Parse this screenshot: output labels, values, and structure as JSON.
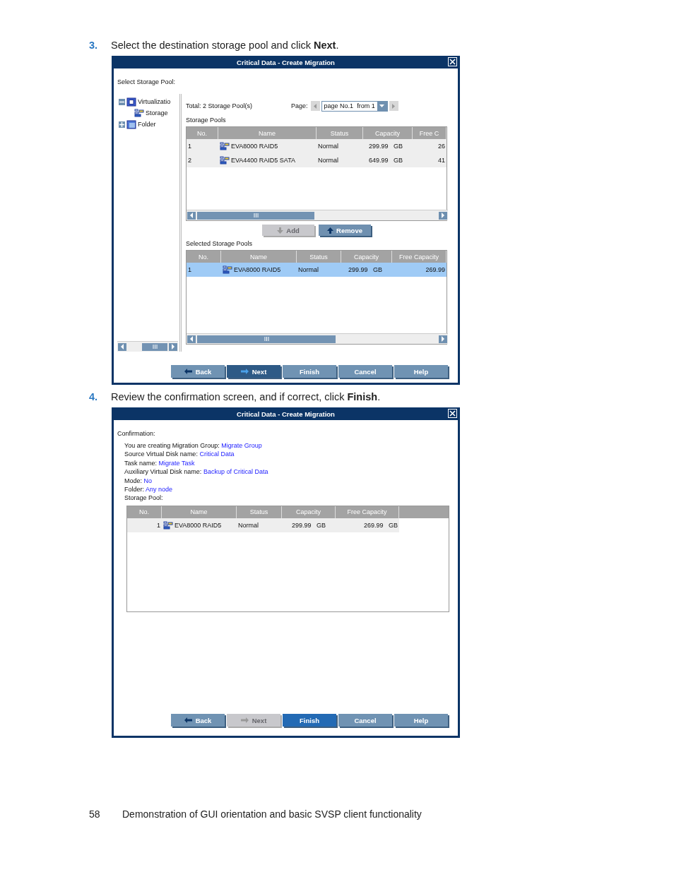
{
  "steps": [
    {
      "number": "3.",
      "text": "Select the destination storage pool and click **Next**.",
      "dialog": {
        "kind": "select_pool",
        "title": "Critical Data - Create Migration",
        "prompt": "Select Storage Pool:",
        "tree": [
          {
            "label": "Virtualizatio",
            "kind": "virtualization",
            "expanded": true,
            "children": [
              {
                "label": "Storage",
                "kind": "storage"
              }
            ]
          },
          {
            "label": "Folder",
            "kind": "folder",
            "expanded": false
          }
        ],
        "total": "Total: 2 Storage Pool(s)",
        "page_label": "Page:",
        "page_select": "page No.1  from 1",
        "available": {
          "label": "Storage Pools",
          "columns": [
            "No.",
            "Name",
            "Status",
            "Capacity",
            "Free C"
          ],
          "rows": [
            {
              "selected": false,
              "cells": [
                "1",
                "EVA8000 RAID5",
                "Normal",
                "299.99   GB",
                "26"
              ]
            },
            {
              "selected": false,
              "cells": [
                "2",
                "EVA4400 RAID5 SATA",
                "Normal",
                "649.99   GB",
                "41"
              ]
            }
          ]
        },
        "add_button": {
          "label": "Add",
          "disabled": true
        },
        "remove_button": {
          "label": "Remove",
          "disabled": false
        },
        "selected": {
          "label": "Selected Storage Pools",
          "columns": [
            "No.",
            "Name",
            "Status",
            "Capacity",
            "Free Capacity"
          ],
          "rows": [
            {
              "selected": true,
              "cells": [
                "1",
                "EVA8000 RAID5",
                "Normal",
                "299.99   GB",
                "269.99"
              ]
            }
          ]
        },
        "nav": [
          {
            "label": "Back",
            "kind": "normal"
          },
          {
            "label": "Next",
            "kind": "pressed"
          },
          {
            "label": "Finish",
            "kind": "normal"
          },
          {
            "label": "Cancel",
            "kind": "normal"
          },
          {
            "label": "Help",
            "kind": "normal"
          }
        ]
      }
    },
    {
      "number": "4.",
      "text": "Review the confirmation screen, and if correct, click **Finish**.",
      "dialog": {
        "kind": "confirm",
        "title": "Critical Data - Create Migration",
        "prompt": "Confirmation:",
        "details": [
          {
            "label": "You are creating Migration Group:",
            "value": "Migrate Group"
          },
          {
            "label": "Source Virtual Disk name:",
            "value": "Critical Data"
          },
          {
            "label": "Task name:",
            "value": "Migrate Task"
          },
          {
            "label": "Auxiliary Virtual Disk name:",
            "value": "Backup of Critical Data"
          },
          {
            "label": "Mode:",
            "value": "No"
          },
          {
            "label": "Folder:",
            "value": "Any node"
          }
        ],
        "table_label": "Storage Pool:",
        "table": {
          "columns": [
            "No.",
            "Name",
            "Status",
            "Capacity",
            "Free Capacity"
          ],
          "rows": [
            {
              "selected": false,
              "cells": [
                "1",
                "EVA8000 RAID5",
                "Normal",
                "299.99   GB",
                "269.99   GB"
              ]
            }
          ]
        },
        "nav": [
          {
            "label": "Back",
            "kind": "normal"
          },
          {
            "label": "Next",
            "kind": "disabled"
          },
          {
            "label": "Finish",
            "kind": "default"
          },
          {
            "label": "Cancel",
            "kind": "normal"
          },
          {
            "label": "Help",
            "kind": "normal"
          }
        ]
      }
    }
  ],
  "footer": {
    "page_number": "58",
    "text": "Demonstration of GUI orientation and basic SVSP client functionality"
  }
}
